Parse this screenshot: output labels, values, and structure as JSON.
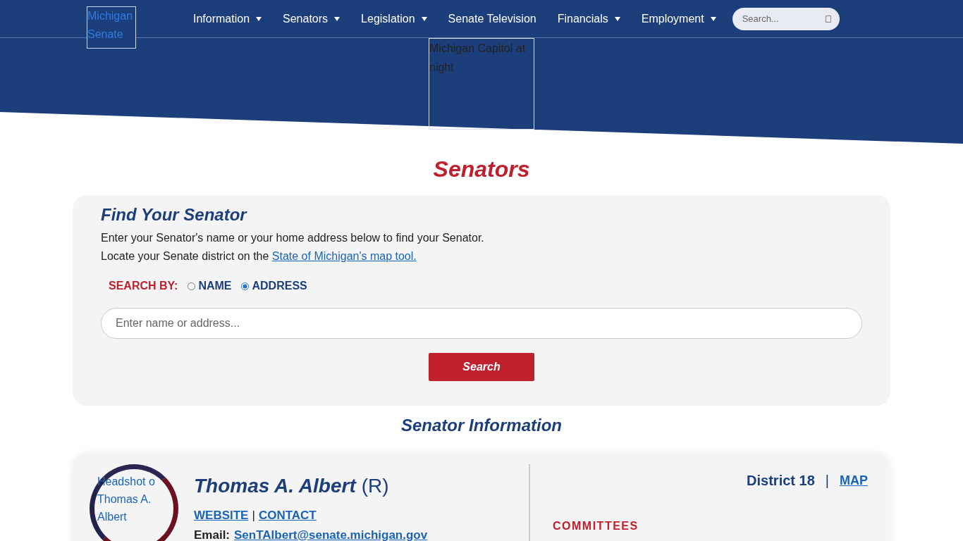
{
  "logo": {
    "alt": "Michigan Senate"
  },
  "nav": [
    {
      "label": "Information",
      "dropdown": true
    },
    {
      "label": "Senators",
      "dropdown": true
    },
    {
      "label": "Legislation",
      "dropdown": true
    },
    {
      "label": "Senate Television",
      "dropdown": false
    },
    {
      "label": "Financials",
      "dropdown": true
    },
    {
      "label": "Employment",
      "dropdown": true
    }
  ],
  "nav_search": {
    "placeholder": "Search..."
  },
  "hero_image": {
    "alt": "Michigan Capitol at night"
  },
  "page_title": "Senators",
  "finder": {
    "title": "Find Your Senator",
    "line_1": "Enter your Senator's name or your home address below to find your Senator.",
    "line_2": "Locate your Senate district on the ",
    "link": "State of Michigan's map tool.",
    "search_by": "SEARCH BY:",
    "options": [
      {
        "label": "NAME",
        "selected": false
      },
      {
        "label": "ADDRESS",
        "selected": true
      }
    ],
    "field": {
      "placeholder": "Enter name or address..."
    },
    "button": "Search"
  },
  "section_title": "Senator Information",
  "senator": {
    "headshot_alt": "Headshot o Thomas A. Albert",
    "name": "Thomas A. Albert",
    "party": "(R)",
    "district": "District 18",
    "separator": "|",
    "map": "MAP",
    "website": "WEBSITE",
    "link_sep": "|",
    "contact": "CONTACT",
    "email_label": "Email:",
    "email": "SenTAlbert@senate.michigan.gov",
    "committees": "COMMITTEES"
  }
}
